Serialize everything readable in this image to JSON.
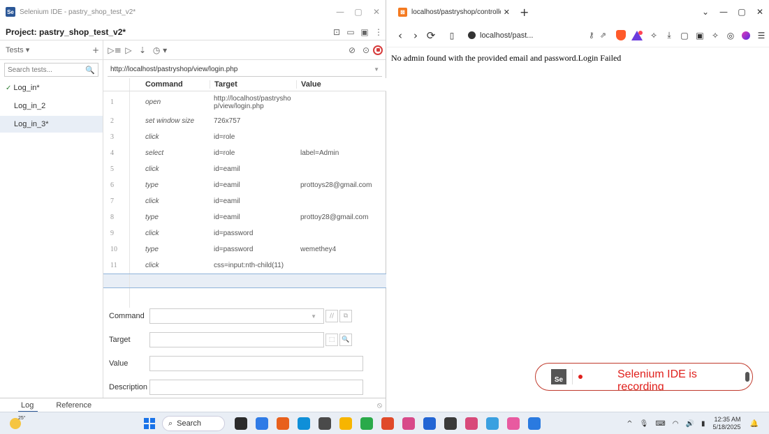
{
  "ide": {
    "window_title": "Selenium IDE - pastry_shop_test_v2*",
    "project_label": "Project: pastry_shop_test_v2*",
    "tests_header": "Tests",
    "tests_dropdown_glyph": "▾",
    "search_placeholder": "Search tests...",
    "tests": [
      {
        "name": "Log_in*",
        "passed": true
      },
      {
        "name": "Log_in_2",
        "passed": false
      },
      {
        "name": "Log_in_3*",
        "passed": false
      }
    ],
    "base_url": "http://localhost/pastryshop/view/login.php",
    "columns": {
      "command": "Command",
      "target": "Target",
      "value": "Value"
    },
    "commands": [
      {
        "num": "1",
        "command": "open",
        "target": "http://localhost/pastrysho\np/view/login.php",
        "value": ""
      },
      {
        "num": "2",
        "command": "set window size",
        "target": "726x757",
        "value": ""
      },
      {
        "num": "3",
        "command": "click",
        "target": "id=role",
        "value": ""
      },
      {
        "num": "4",
        "command": "select",
        "target": "id=role",
        "value": "label=Admin"
      },
      {
        "num": "5",
        "command": "click",
        "target": "id=eamil",
        "value": ""
      },
      {
        "num": "6",
        "command": "type",
        "target": "id=eamil",
        "value": "prottoys28@gmail.com"
      },
      {
        "num": "7",
        "command": "click",
        "target": "id=eamil",
        "value": ""
      },
      {
        "num": "8",
        "command": "type",
        "target": "id=eamil",
        "value": "prottoy28@gmail.com"
      },
      {
        "num": "9",
        "command": "click",
        "target": "id=password",
        "value": ""
      },
      {
        "num": "10",
        "command": "type",
        "target": "id=password",
        "value": "wemethey4"
      },
      {
        "num": "11",
        "command": "click",
        "target": "css=input:nth-child(11)",
        "value": ""
      }
    ],
    "form": {
      "command_label": "Command",
      "target_label": "Target",
      "value_label": "Value",
      "description_label": "Description",
      "command_value": "",
      "target_value": "",
      "value_value": "",
      "description_value": ""
    },
    "footer": {
      "log_tab": "Log",
      "reference_tab": "Reference"
    },
    "icons": {
      "check": "✓",
      "search": "🔍",
      "add": "+",
      "minimize": "—",
      "maximize": "▢",
      "close": "✕",
      "run_all": "▷≡",
      "run": "▷",
      "step": "⇣",
      "speed": "◷ ▾",
      "disable_breakpoints": "⊘",
      "pause_exceptions": "⊙",
      "new_project": "⊡",
      "open_project": "▭",
      "save_project": "▣",
      "more": "⋮",
      "comment": "//",
      "open_ref": "⧉",
      "select_target": "⬚",
      "find_target": "🔍",
      "clear_log": "⦸"
    }
  },
  "browser": {
    "tab_title": "localhost/pastryshop/controller/lo",
    "address": "localhost/past...",
    "page_message": "No admin found with the provided email and password.Login Failed",
    "recording_badge_text": "Selenium IDE is recording",
    "se_logo_text": "Se",
    "icons": {
      "back": "‹",
      "forward": "›",
      "reload": "⟳",
      "bookmark": "▯",
      "key": "⚷",
      "share": "⇗",
      "extensions": "✧",
      "downloads": "⤓",
      "sidebar": "▢",
      "wallet": "▣",
      "leo": "✧",
      "vpn": "◎",
      "menu": "☰",
      "tab_close": "✕",
      "new_tab": "+",
      "chevron": "⌄",
      "minimize": "—",
      "maximize": "▢",
      "close": "✕"
    }
  },
  "taskbar": {
    "temperature": "25°",
    "search_label": "Search",
    "time": "12:35 AM",
    "date": "5/18/2025",
    "app_colors": [
      "#2b2b2b",
      "#2f7be6",
      "#e8601c",
      "#0f8fd8",
      "#4a4a4a",
      "#f7b500",
      "#2aaa4a",
      "#e04a2a",
      "#d84a8a",
      "#2265d4",
      "#3a3a3a",
      "#d84a7a",
      "#3aa0e0",
      "#e85aa0",
      "#2a7ae0"
    ],
    "icons": {
      "chevron_up": "^",
      "mic": "🎙",
      "keyboard": "⌨",
      "wifi": "◠",
      "volume": "🔊",
      "battery": "▮",
      "bell": "🔔"
    }
  }
}
